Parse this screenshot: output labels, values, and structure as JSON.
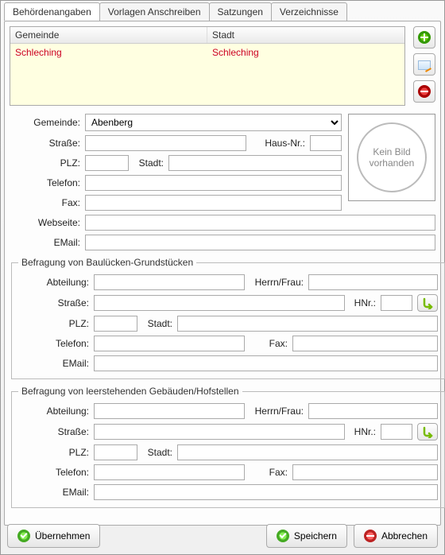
{
  "tabs": {
    "t0": "Behördenangaben",
    "t1": "Vorlagen Anschreiben",
    "t2": "Satzungen",
    "t3": "Verzeichnisse"
  },
  "grid": {
    "header_gemeinde": "Gemeinde",
    "header_stadt": "Stadt",
    "rows": [
      {
        "gemeinde": "Schleching",
        "stadt": "Schleching"
      }
    ]
  },
  "labels": {
    "gemeinde": "Gemeinde:",
    "strasse": "Straße:",
    "hausnr": "Haus-Nr.:",
    "plz": "PLZ:",
    "stadt": "Stadt:",
    "telefon": "Telefon:",
    "fax": "Fax:",
    "webseite": "Webseite:",
    "email": "EMail:",
    "abteilung": "Abteilung:",
    "herrn_frau": "Herrn/Frau:",
    "hnr": "HNr.:",
    "fax2": "Fax:"
  },
  "gemeinde_select": "Abenberg",
  "noimage": "Kein Bild vorhanden",
  "fieldset1_legend": "Befragung von Baulücken-Grundstücken",
  "fieldset2_legend": "Befragung von leerstehenden Gebäuden/Hofstellen",
  "buttons": {
    "uebernehmen": "Übernehmen",
    "speichern": "Speichern",
    "abbrechen": "Abbrechen"
  },
  "values": {
    "strasse": "",
    "hausnr": "",
    "plz": "",
    "stadt": "",
    "telefon": "",
    "fax": "",
    "webseite": "",
    "email": "",
    "f1_abteilung": "",
    "f1_herrn": "",
    "f1_strasse": "",
    "f1_hnr": "",
    "f1_plz": "",
    "f1_stadt": "",
    "f1_telefon": "",
    "f1_fax": "",
    "f1_email": "",
    "f2_abteilung": "",
    "f2_herrn": "",
    "f2_strasse": "",
    "f2_hnr": "",
    "f2_plz": "",
    "f2_stadt": "",
    "f2_telefon": "",
    "f2_fax": "",
    "f2_email": ""
  }
}
